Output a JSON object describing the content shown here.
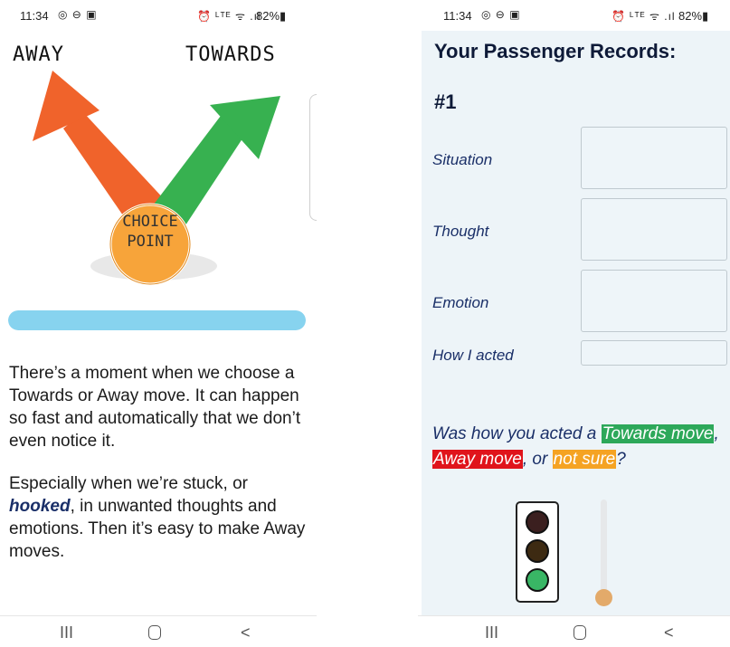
{
  "left_screen": {
    "status": {
      "time": "11:34",
      "icons_left": "◎ ⊖ ▣",
      "icons_right": "⏰ ᴸᵀᴱ ᯤ .ıl",
      "battery": "82%▮"
    },
    "diagram": {
      "away_label": "AWAY",
      "towards_label": "TOWARDS",
      "choice_point_line1": "CHOICE",
      "choice_point_line2": "POINT"
    },
    "progress": {
      "value": 1.0
    },
    "paragraph1": "There’s a moment when we choose a Towards or Away move. It can happen so fast and automatically that we don’t even notice it.",
    "paragraph2_before": "Especially when we’re stuck, or ",
    "paragraph2_hooked": "hooked",
    "paragraph2_after": ", in unwanted thoughts and emotions. Then it’s easy to make Away moves.",
    "nav": {
      "recents": "III",
      "back": "<"
    }
  },
  "right_screen": {
    "status": {
      "time": "11:34",
      "icons_left": "◎ ⊖ ▣",
      "icons_right": "⏰ ᴸᵀᴱ ᯤ .ıl",
      "battery": "82%▮"
    },
    "title": "Your Passenger Records:",
    "record_number": "#1",
    "fields": [
      {
        "label": "Situation",
        "value": ""
      },
      {
        "label": "Thought",
        "value": ""
      },
      {
        "label": "Emotion",
        "value": ""
      },
      {
        "label": "How I acted",
        "value": ""
      }
    ],
    "question_start": "Was how you acted a ",
    "option_towards": "Towards move",
    "sep1": ", ",
    "option_away": "Away move",
    "sep2": ", or ",
    "option_unsure": "not sure",
    "question_end": "?",
    "slider": {
      "value": 0
    },
    "nav": {
      "recents": "III",
      "back": "<"
    },
    "colors": {
      "towards": "#2da85a",
      "away": "#e0141b",
      "unsure": "#f5a323"
    }
  }
}
